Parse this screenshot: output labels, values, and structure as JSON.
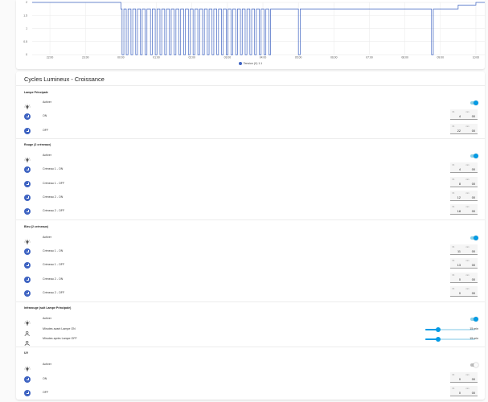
{
  "chart_data": {
    "type": "line",
    "x_ticks": [
      "22:00",
      "23:00",
      "00:00",
      "01:00",
      "02:00",
      "03:00",
      "04:00",
      "05:00",
      "06:00",
      "07:00",
      "08:00",
      "09:00",
      "10:00"
    ],
    "y_ticks": [
      "2",
      "1.5",
      "1",
      "0.5",
      "0"
    ],
    "ylim": [
      0,
      2
    ],
    "grid": true,
    "legend_position": "bottom-center",
    "series": [
      {
        "name": "Tension (V) 1.1",
        "color": "#3f64c2",
        "points": [
          [
            "21:30",
            2
          ],
          [
            "00:00",
            2
          ],
          [
            "00:00",
            1.75
          ],
          [
            "00:02",
            1.75
          ],
          [
            "00:02",
            0
          ],
          [
            "00:05",
            0
          ],
          [
            "00:05",
            1.75
          ],
          [
            "00:09",
            1.75
          ],
          [
            "00:09",
            0
          ],
          [
            "00:12",
            0
          ],
          [
            "00:12",
            1.75
          ],
          [
            "00:17",
            1.75
          ],
          [
            "00:17",
            0
          ],
          [
            "00:20",
            0
          ],
          [
            "00:20",
            1.75
          ],
          [
            "00:25",
            1.75
          ],
          [
            "00:25",
            0
          ],
          [
            "00:28",
            0
          ],
          [
            "00:28",
            1.75
          ],
          [
            "00:33",
            1.75
          ],
          [
            "00:33",
            0
          ],
          [
            "00:36",
            0
          ],
          [
            "00:36",
            1.75
          ],
          [
            "00:41",
            1.75
          ],
          [
            "00:41",
            0
          ],
          [
            "00:44",
            0
          ],
          [
            "00:44",
            1.75
          ],
          [
            "00:50",
            1.75
          ],
          [
            "00:50",
            0
          ],
          [
            "00:53",
            0
          ],
          [
            "00:53",
            1.75
          ],
          [
            "00:58",
            1.75
          ],
          [
            "00:58",
            0
          ],
          [
            "01:01",
            0
          ],
          [
            "01:01",
            1.75
          ],
          [
            "01:06",
            1.75
          ],
          [
            "01:06",
            0
          ],
          [
            "01:09",
            0
          ],
          [
            "01:09",
            1.75
          ],
          [
            "01:14",
            1.75
          ],
          [
            "01:14",
            0
          ],
          [
            "01:17",
            0
          ],
          [
            "01:17",
            1.75
          ],
          [
            "01:22",
            1.75
          ],
          [
            "01:22",
            0
          ],
          [
            "01:25",
            0
          ],
          [
            "01:25",
            1.75
          ],
          [
            "01:30",
            1.75
          ],
          [
            "01:30",
            0
          ],
          [
            "01:33",
            0
          ],
          [
            "01:33",
            1.75
          ],
          [
            "01:38",
            1.75
          ],
          [
            "01:38",
            0
          ],
          [
            "01:41",
            0
          ],
          [
            "01:41",
            1.75
          ],
          [
            "01:46",
            1.75
          ],
          [
            "01:46",
            0
          ],
          [
            "01:49",
            0
          ],
          [
            "01:49",
            1.75
          ],
          [
            "01:54",
            1.75
          ],
          [
            "01:54",
            0
          ],
          [
            "01:57",
            0
          ],
          [
            "01:57",
            1.75
          ],
          [
            "02:02",
            1.75
          ],
          [
            "02:02",
            0
          ],
          [
            "02:05",
            0
          ],
          [
            "02:05",
            1.75
          ],
          [
            "02:10",
            1.75
          ],
          [
            "02:10",
            0
          ],
          [
            "02:13",
            0
          ],
          [
            "02:13",
            1.75
          ],
          [
            "02:18",
            1.75
          ],
          [
            "02:18",
            0
          ],
          [
            "02:21",
            0
          ],
          [
            "02:21",
            1.75
          ],
          [
            "02:26",
            1.75
          ],
          [
            "02:26",
            0
          ],
          [
            "02:29",
            0
          ],
          [
            "02:29",
            1.75
          ],
          [
            "02:34",
            1.75
          ],
          [
            "02:34",
            0
          ],
          [
            "02:37",
            0
          ],
          [
            "02:37",
            1.75
          ],
          [
            "02:42",
            1.75
          ],
          [
            "02:42",
            0
          ],
          [
            "02:45",
            0
          ],
          [
            "02:45",
            1.75
          ],
          [
            "02:50",
            1.75
          ],
          [
            "02:50",
            0
          ],
          [
            "02:53",
            0
          ],
          [
            "02:53",
            1.75
          ],
          [
            "02:58",
            1.75
          ],
          [
            "02:58",
            0
          ],
          [
            "03:01",
            0
          ],
          [
            "03:01",
            1.75
          ],
          [
            "03:06",
            1.75
          ],
          [
            "03:06",
            0
          ],
          [
            "03:09",
            0
          ],
          [
            "03:09",
            1.75
          ],
          [
            "03:14",
            1.75
          ],
          [
            "03:14",
            0
          ],
          [
            "03:17",
            0
          ],
          [
            "03:17",
            1.75
          ],
          [
            "03:22",
            1.75
          ],
          [
            "03:22",
            0
          ],
          [
            "03:25",
            0
          ],
          [
            "03:25",
            1.75
          ],
          [
            "03:30",
            1.75
          ],
          [
            "03:30",
            0
          ],
          [
            "03:33",
            0
          ],
          [
            "03:33",
            1.75
          ],
          [
            "03:38",
            1.75
          ],
          [
            "03:38",
            0
          ],
          [
            "03:41",
            0
          ],
          [
            "03:41",
            1.75
          ],
          [
            "03:46",
            1.75
          ],
          [
            "03:46",
            0
          ],
          [
            "03:49",
            0
          ],
          [
            "03:49",
            1.75
          ],
          [
            "03:54",
            1.75
          ],
          [
            "03:54",
            0
          ],
          [
            "03:57",
            0
          ],
          [
            "03:57",
            1.75
          ],
          [
            "04:02",
            1.75
          ],
          [
            "04:02",
            0
          ],
          [
            "04:05",
            0
          ],
          [
            "04:05",
            1.75
          ],
          [
            "04:10",
            1.75
          ],
          [
            "04:10",
            0
          ],
          [
            "04:13",
            0
          ],
          [
            "04:13",
            1.75
          ],
          [
            "05:00",
            1.75
          ],
          [
            "05:00",
            0
          ],
          [
            "05:03",
            0
          ],
          [
            "05:03",
            1.75
          ],
          [
            "08:45",
            1.75
          ],
          [
            "08:45",
            0
          ],
          [
            "08:48",
            0
          ],
          [
            "08:48",
            1.75
          ],
          [
            "09:30",
            1.75
          ],
          [
            "09:30",
            1.9
          ],
          [
            "10:00",
            1.9
          ],
          [
            "10:00",
            2
          ],
          [
            "10:16",
            2
          ],
          [
            "10:16",
            1.75
          ],
          [
            "10:25",
            1.75
          ]
        ]
      }
    ]
  },
  "card": {
    "title": "Cycles Lumineux - Croissance"
  },
  "units": {
    "hours": "hh",
    "minutes": "mm"
  },
  "sections": {
    "lampe": {
      "title": "Lampe Principale",
      "activer": "Activer",
      "on_label": "ON",
      "on_h": "4",
      "on_m": "00",
      "off_label": "OFF",
      "off_h": "22",
      "off_m": "00"
    },
    "rouge": {
      "title": "Rouge (2 créneaux)",
      "activer": "Activer",
      "r1on_label": "Créneau 1 - ON",
      "r1on_h": "4",
      "r1on_m": "00",
      "r1off_label": "Créneau 1 - OFF",
      "r1off_h": "8",
      "r1off_m": "00",
      "r2on_label": "Créneau 2 - ON",
      "r2on_h": "12",
      "r2on_m": "00",
      "r2off_label": "Créneau 2 - OFF",
      "r2off_h": "18",
      "r2off_m": "00"
    },
    "bleu": {
      "title": "Bleu (2 créneaux)",
      "activer": "Activer",
      "b1on_label": "Créneau 1 - ON",
      "b1on_h": "11",
      "b1on_m": "00",
      "b1off_label": "Créneau 1 - OFF",
      "b1off_h": "13",
      "b1off_m": "00",
      "b2on_label": "Créneau 2 - ON",
      "b2on_h": "0",
      "b2on_m": "00",
      "b2off_label": "Créneau 2 - OFF",
      "b2off_h": "0",
      "b2off_m": "00"
    },
    "ir": {
      "title": "Infrarouge (suit Lampe Principale)",
      "activer": "Activer",
      "before_label": "Minutes avant Lampe ON",
      "before_value": "15 min",
      "before_fraction": 0.25,
      "after_label": "Minutes après Lampe OFF",
      "after_value": "15 min",
      "after_fraction": 0.25
    },
    "uv": {
      "title": "UV",
      "activer": "Activer",
      "on_label": "ON",
      "on_h": "0",
      "on_m": "00",
      "off_label": "OFF",
      "off_h": "0",
      "off_m": "00"
    }
  },
  "toggles": {
    "lampe": true,
    "rouge": true,
    "bleu": true,
    "ir": true,
    "uv": false
  },
  "colors": {
    "accent": "#039be5",
    "series": "#3f64c2",
    "icon": "#3f64c2"
  }
}
